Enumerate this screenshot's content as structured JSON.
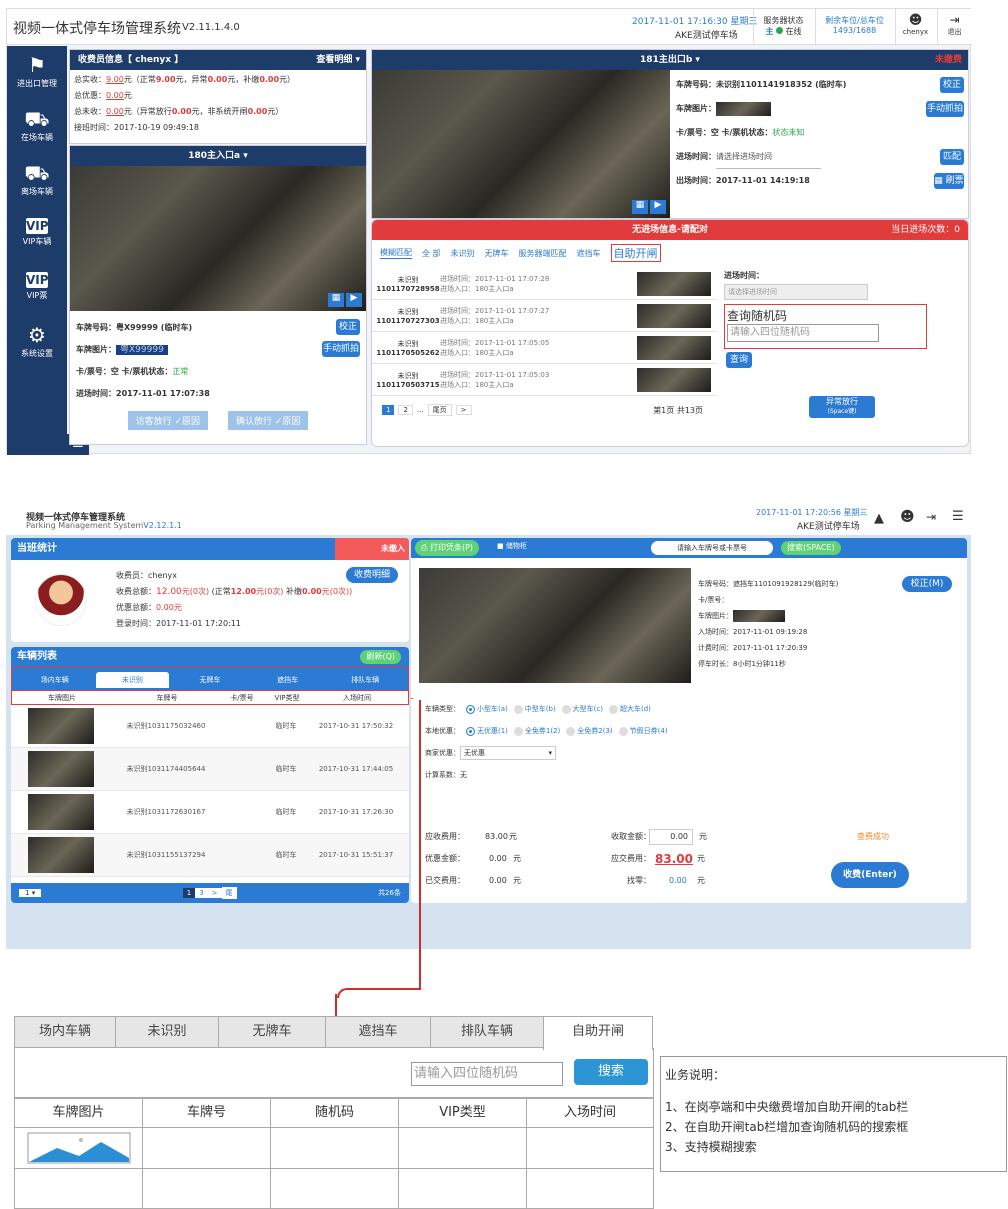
{
  "s1": {
    "app_title": "视频一体式停车场管理系统",
    "version": "V2.11.1.4.0",
    "datetime": "2017-11-01 17:16:30 星期三",
    "lot_name": "AKE测试停车场",
    "server_status_label": "服务器状态",
    "server_main": "主",
    "server_online": "在线",
    "remaining_label": "剩余车位/总车位",
    "remaining_value": "1493/1688",
    "user": "chenyx",
    "logout": "退出",
    "sidebar": [
      {
        "label": "进出口管理",
        "icon": "barrier-gate-icon"
      },
      {
        "label": "在场车辆",
        "icon": "car-icon"
      },
      {
        "label": "离场车辆",
        "icon": "car-leave-icon"
      },
      {
        "label": "VIP车辆",
        "icon": "vip-icon"
      },
      {
        "label": "VIP票",
        "icon": "vip-ticket-icon"
      },
      {
        "label": "系统设置",
        "icon": "gear-icon"
      }
    ],
    "cashier": {
      "title": "收费员信息【 chenyx 】",
      "detail_link": "查看明细",
      "real_label": "总实收：",
      "real_value": "9.00",
      "real_normal_pre": "元（正常",
      "real_normal": "9.00",
      "real_abnormal_pre": "元，异常",
      "real_abnormal": "0.00",
      "real_add_pre": "元，补缴",
      "real_add": "0.00",
      "real_end": "元）",
      "discount_label": "总优惠：",
      "discount_value": "0.00",
      "discount_unit": "元",
      "unpaid_label": "总未收：",
      "unpaid_value": "0.00",
      "unpaid_mid1": "元（异常放行",
      "unpaid_v1": "0.00",
      "unpaid_mid2": "元，非系统开闸",
      "unpaid_v2": "0.00",
      "unpaid_end": "元）",
      "login_label": "接班时间：",
      "login_value": "2017-10-19 09:49:18"
    },
    "entry": {
      "camera_title": "180主入口a",
      "plate_label": "车牌号码：",
      "plate_value": "粤X99999 (临时车)",
      "correct_btn": "校正",
      "plate_img_label": "车牌图片：",
      "plate_img_text": "粤X99999",
      "manual_btn": "手动抓拍",
      "card_label": "卡/票号：空",
      "card_status_label": "卡/票机状态：",
      "card_status": "正常",
      "time_label": "进场时间：",
      "time_value": "2017-11-01 17:07:38",
      "visitor_btn": "访客放行",
      "visitor_check": "原因",
      "confirm_btn": "确认放行",
      "confirm_check": "原因"
    },
    "exit": {
      "camera_title": "181主出口b",
      "unpaid_tag": "未缴费",
      "plate_label": "车牌号码：",
      "plate_value": "未识别1101141918352 (临时车)",
      "correct_btn": "校正",
      "plate_img_label": "车牌图片：",
      "manual_btn": "手动抓拍",
      "card_label": "卡/票号：空",
      "card_status_label": "卡/票机状态：",
      "card_status": "状态未知",
      "in_label": "进场时间：",
      "in_placeholder": "请选择进场时间",
      "match_btn": "匹配",
      "out_label": "出场时间：",
      "out_value": "2017-11-01 14:19:18",
      "refresh_btn": "刷票"
    },
    "noentry": {
      "title": "无进场信息-请配对",
      "today_count": "当日进场次数：0",
      "tabs": [
        "模糊匹配",
        "全 部",
        "未识别",
        "无牌车",
        "服务器端匹配",
        "遮挡车"
      ],
      "self_tab": "自助开闸",
      "rows": [
        {
          "name": "未识别",
          "id": "1101170728958",
          "t": "进场时间：2017-11-01 17:07:28",
          "gate": "进场入口：180主入口a"
        },
        {
          "name": "未识别",
          "id": "1101170727303",
          "t": "进场时间：2017-11-01 17:07:27",
          "gate": "进场入口：180主入口a"
        },
        {
          "name": "未识别",
          "id": "1101170505262",
          "t": "进场时间：2017-11-01 17:05:05",
          "gate": "进场入口：180主入口a"
        },
        {
          "name": "未识别",
          "id": "1101170503715",
          "t": "进场时间：2017-11-01 17:05:03",
          "gate": "进场入口：180主入口a"
        }
      ],
      "in_time_label": "进场时间：",
      "in_time_placeholder": "请选择进场时间",
      "query_title": "查询随机码",
      "query_placeholder": "请输入四位随机码",
      "query_btn": "查询",
      "pages": [
        "1",
        "2",
        "...",
        "尾页",
        ">"
      ],
      "page_info": "第1页 共13页",
      "abnormal_btn": "异常放行",
      "abnormal_sub": "(Space键)"
    }
  },
  "s2": {
    "title": "视频一体式停车管理系统",
    "subtitle_en": "Parking Management System",
    "version": "V2.12.1.1",
    "datetime": "2017-11-01 17:20:56 星期三",
    "lot_name": "AKE测试停车场",
    "shift_title": "当班统计",
    "unpaid_flag": "未缴入",
    "cashier_label": "收费员：",
    "cashier_name": "chenyx",
    "detail_btn": "收费明细",
    "amount_label": "收费总额：",
    "amount_value": "12.00",
    "amount_unit1": "元",
    "amount_count1": "(0次)",
    "normal_label": "(正常",
    "normal_value": "12.00",
    "normal_unit": "元",
    "normal_count": "(0次)",
    "add_label": "补缴",
    "add_value": "0.00",
    "add_unit": "元",
    "add_count": "(0次))",
    "discount_label": "优惠总额：",
    "discount_value": "0.00",
    "discount_unit": "元",
    "login_label": "登录时间：",
    "login_value": "2017-11-01 17:20:11",
    "list_title": "车辆列表",
    "refresh_btn": "刷新(Q)",
    "tabs": [
      "场内车辆",
      "未识别",
      "无牌车",
      "遮挡车",
      "排队车辆"
    ],
    "cols": [
      "车牌图片",
      "车牌号",
      "卡/票号",
      "VIP类型",
      "入场时间"
    ],
    "rows": [
      {
        "plate": "未识别1031175032460",
        "type": "临时车",
        "time": "2017-10-31 17:50:32"
      },
      {
        "plate": "未识别1031174405644",
        "type": "临时车",
        "time": "2017-10-31 17:44:05"
      },
      {
        "plate": "未识别1031172630167",
        "type": "临时车",
        "time": "2017-10-31 17:26:30"
      },
      {
        "plate": "未识别1031155137294",
        "type": "临时车",
        "time": "2017-10-31 15:51:37"
      }
    ],
    "page_size": "1",
    "pages": [
      "1",
      "3",
      ">",
      "尾"
    ],
    "total": "共26条",
    "print_btn": "打印凭条(P)",
    "small_flag": "储物柜",
    "search_placeholder": "请输入车牌号或卡票号",
    "search_btn": "搜索(SPACE)",
    "info": {
      "plate_label": "车牌号码：",
      "plate_value": "遮挡车1101091928129(临时车)",
      "correct_btn": "校正(M)",
      "card_label": "卡/票号：",
      "img_label": "车牌图片：",
      "in_label": "入场时间：",
      "in_value": "2017-11-01 09:19:28",
      "calc_label": "计费时间：",
      "calc_value": "2017-11-01 17:20:39",
      "stay_label": "停车时长：",
      "stay_value": "8小时1分钟11秒"
    },
    "vehicle_type_label": "车辆类型：",
    "vehicle_types": [
      "小型车(a)",
      "中型车(b)",
      "大型车(c)",
      "超大车(d)"
    ],
    "discount_opt_label": "本地优惠：",
    "discount_opts": [
      "无优惠(1)",
      "全免券1(2)",
      "全免券2(3)",
      "节假日券(4)"
    ],
    "merchant_label": "商家优惠：",
    "merchant_value": "无优惠",
    "coef_label": "计算系数：",
    "coef_value": "无",
    "fee_label": "应收费用：",
    "fee_value": "83.00",
    "fee_unit": "元",
    "recv_label": "收取金额：",
    "recv_value": "0.00",
    "recv_unit": "元",
    "query_ok": "查费成功",
    "disc_label": "优惠金额：",
    "disc_value": "0.00",
    "disc_unit": "元",
    "pay_label": "应交费用：",
    "pay_value": "83.00",
    "pay_unit": "元",
    "paid_label": "已交费用：",
    "paid_value": "0.00",
    "paid_unit": "元",
    "change_label": "找零：",
    "change_value": "0.00",
    "change_unit": "元",
    "charge_btn": "收费(Enter)"
  },
  "wire": {
    "tabs": [
      "场内车辆",
      "未识别",
      "无牌车",
      "遮挡车",
      "排队车辆",
      "自助开闸"
    ],
    "search_placeholder": "请输入四位随机码",
    "search_btn": "搜索",
    "cols": [
      "车牌图片",
      "车牌号",
      "随机码",
      "VIP类型",
      "入场时间"
    ]
  },
  "notes": {
    "title": "业务说明：",
    "items": [
      "1、在岗亭端和中央缴费增加自助开闸的tab栏",
      "2、在自助开闸tab栏增加查询随机码的搜索框",
      "3、支持模糊搜索"
    ]
  }
}
